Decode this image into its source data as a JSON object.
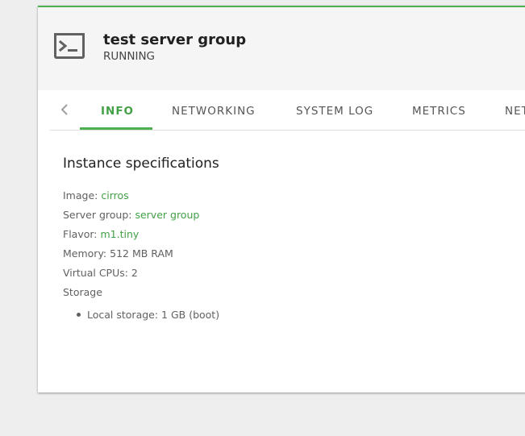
{
  "instance": {
    "name": "test server group",
    "status": "RUNNING"
  },
  "tabs": [
    {
      "label": "INFO",
      "active": true
    },
    {
      "label": "NETWORKING",
      "active": false
    },
    {
      "label": "SYSTEM LOG",
      "active": false
    },
    {
      "label": "METRICS",
      "active": false
    },
    {
      "label": "NET",
      "active": false
    }
  ],
  "specs": {
    "title": "Instance specifications",
    "image_label": "Image:",
    "image_value": "cirros",
    "server_group_label": "Server group:",
    "server_group_value": "server group",
    "flavor_label": "Flavor:",
    "flavor_value": "m1.tiny",
    "memory_text": "Memory: 512 MB RAM",
    "vcpus_text": "Virtual CPUs: 2",
    "storage_label": "Storage",
    "storage_items": [
      "Local storage: 1 GB (boot)"
    ]
  },
  "icons": {
    "instance": "terminal-icon",
    "tabs_scroll": "chevron-left-icon"
  },
  "colors": {
    "accent": "#4caf50",
    "link": "#43a047",
    "header_bg": "#f5f5f5",
    "page_bg": "#eeeeee"
  }
}
